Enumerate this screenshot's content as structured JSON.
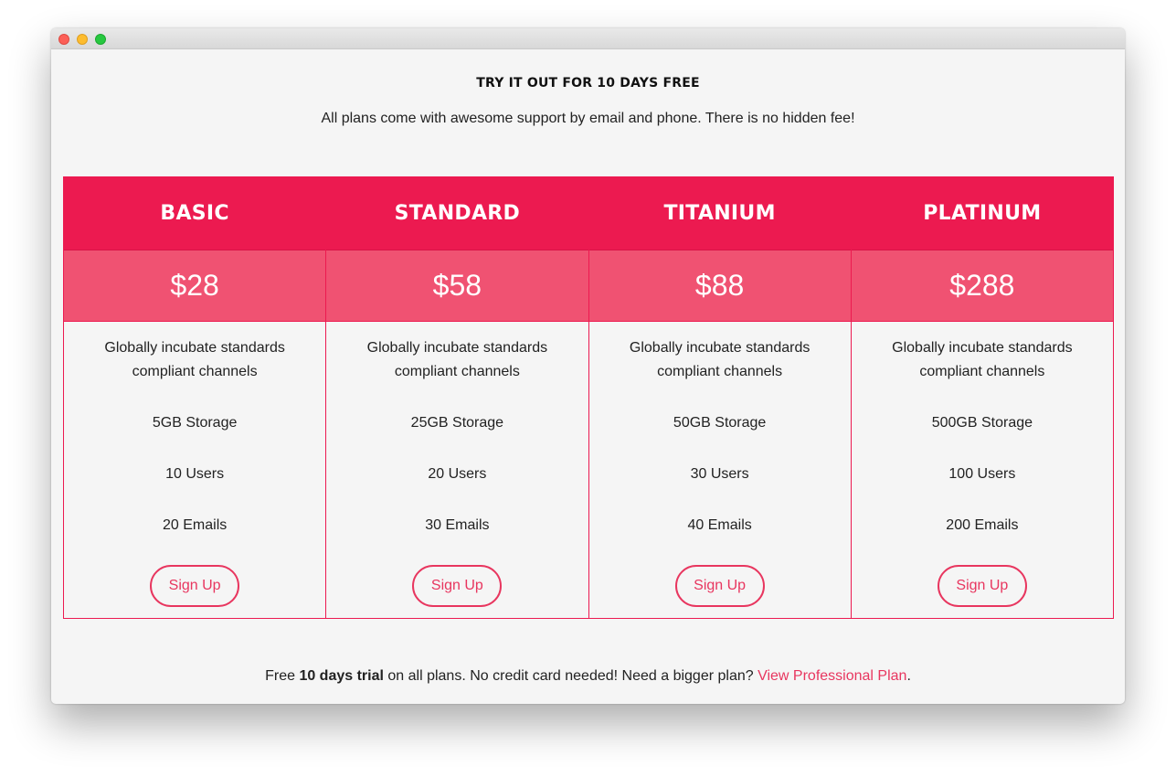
{
  "window": {
    "buttons": [
      "close",
      "minimize",
      "zoom"
    ]
  },
  "header": {
    "title": "TRY IT OUT FOR 10 DAYS FREE",
    "subtitle": "All plans come with awesome support by email and phone. There is no hidden fee!"
  },
  "plans": [
    {
      "name": "BASIC",
      "price": "$28",
      "description": "Globally incubate standards compliant channels",
      "storage": "5GB Storage",
      "users": "10 Users",
      "emails": "20 Emails",
      "cta": "Sign Up"
    },
    {
      "name": "STANDARD",
      "price": "$58",
      "description": "Globally incubate standards compliant channels",
      "storage": "25GB Storage",
      "users": "20 Users",
      "emails": "30 Emails",
      "cta": "Sign Up"
    },
    {
      "name": "TITANIUM",
      "price": "$88",
      "description": "Globally incubate standards compliant channels",
      "storage": "50GB Storage",
      "users": "30 Users",
      "emails": "40 Emails",
      "cta": "Sign Up"
    },
    {
      "name": "PLATINUM",
      "price": "$288",
      "description": "Globally incubate standards compliant channels",
      "storage": "500GB Storage",
      "users": "100 Users",
      "emails": "200 Emails",
      "cta": "Sign Up"
    }
  ],
  "footer": {
    "prefix": "Free ",
    "bold": "10 days trial",
    "middle": " on all plans. No credit card needed! Need a bigger plan? ",
    "link": "View Professional Plan",
    "suffix": "."
  },
  "colors": {
    "accent": "#ec1a50",
    "price_band": "#f05272",
    "button": "#e8365f",
    "background": "#f5f5f5"
  }
}
